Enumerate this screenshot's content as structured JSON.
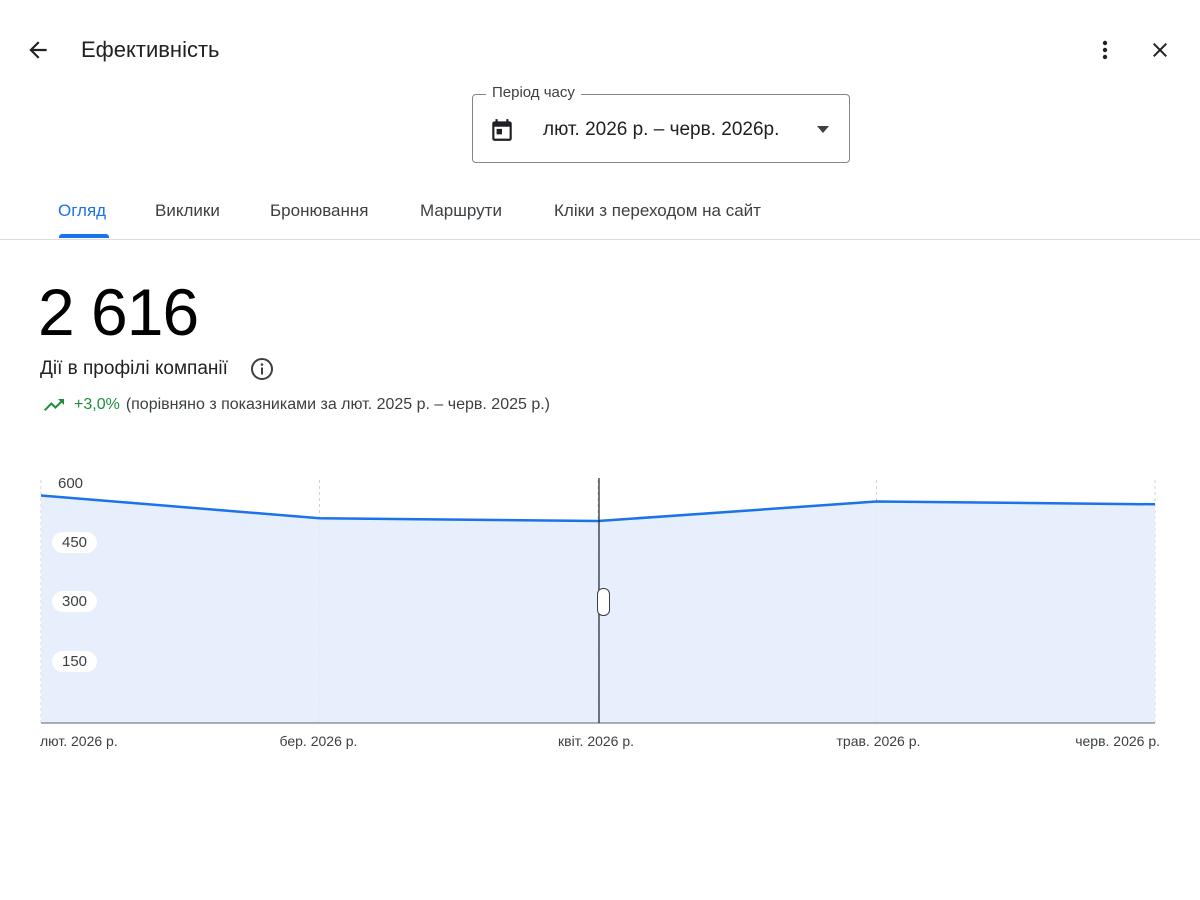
{
  "header": {
    "title": "Ефективність"
  },
  "period": {
    "label": "Період часу",
    "value": "лют. 2026 р. – черв. 2026р."
  },
  "tabs": [
    {
      "label": "Огляд",
      "active": true
    },
    {
      "label": "Виклики",
      "active": false
    },
    {
      "label": "Бронювання",
      "active": false
    },
    {
      "label": "Маршрути",
      "active": false
    },
    {
      "label": "Кліки з переходом на сайт",
      "active": false
    }
  ],
  "summary": {
    "total": "2 616",
    "metric_label": "Дії в профілі компанії",
    "trend_pct": "+3,0%",
    "trend_compare": "(порівняно з показниками за лют. 2025 р. – черв. 2025 р.)"
  },
  "colors": {
    "accent": "#1a73e8",
    "area_fill": "#e3ecfb",
    "trend_up": "#1e8e3e"
  },
  "icons": {
    "back": "arrow-back-icon",
    "more": "more-vert-icon",
    "close": "close-icon",
    "calendar": "calendar-icon",
    "dropdown": "dropdown-arrow-icon",
    "info": "info-icon",
    "trend": "trending-up-icon"
  },
  "chart_data": {
    "type": "area",
    "x": [
      "лют. 2026 р.",
      "бер. 2026 р.",
      "квіт. 2026 р.",
      "трав. 2026 р.",
      "черв. 2026 р."
    ],
    "series": [
      {
        "values": [
          571,
          514,
          507,
          556,
          549
        ]
      }
    ],
    "y_ticks": [
      "600",
      "450",
      "300",
      "150"
    ],
    "ylim": [
      0,
      610
    ],
    "grid": "vertical-dashed",
    "selected_index": 2
  }
}
